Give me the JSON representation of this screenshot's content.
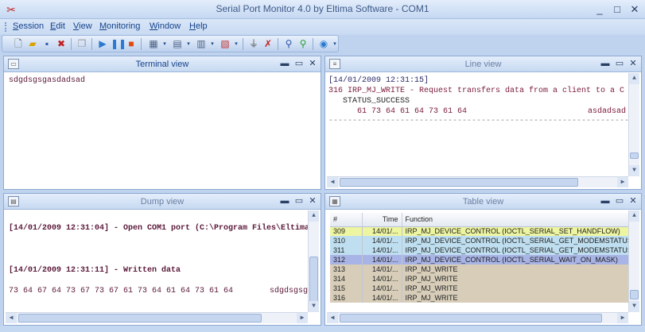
{
  "window": {
    "title": "Serial Port Monitor 4.0 by Eltima Software - COM1",
    "minimize_glyph": "_",
    "maximize_glyph": "□",
    "close_glyph": "✕"
  },
  "menu": {
    "items": [
      {
        "label": "Session",
        "underline": "S"
      },
      {
        "label": "Edit",
        "underline": "E"
      },
      {
        "label": "View",
        "underline": "V"
      },
      {
        "label": "Monitoring",
        "underline": "M"
      },
      {
        "label": "Window",
        "underline": "W"
      },
      {
        "label": "Help",
        "underline": "H"
      }
    ]
  },
  "toolbar": {
    "icons": [
      "new-session-icon",
      "open-icon",
      "save-icon",
      "close-session-icon",
      "copy-icon",
      "start-icon",
      "pause-icon",
      "stop-icon",
      "table-layout-icon",
      "view-layout-icon",
      "dump-layout-icon",
      "line-layout-icon",
      "filter-icon",
      "clear-icon",
      "find-icon",
      "find-next-icon",
      "settings-icon"
    ]
  },
  "panels": {
    "terminal": {
      "title": "Terminal view",
      "content": "sdgdsgsgasdadsad"
    },
    "line": {
      "title": "Line view",
      "timestamp": "[14/01/2009 12:31:15]",
      "request_line": "316  IRP_MJ_WRITE - Request transfers data from a client to a C",
      "status": "STATUS_SUCCESS",
      "hex": "61 73 64 61 64 73 61 64",
      "ascii": "asdadsad",
      "divider": "-------------------------------------------------------------------"
    },
    "dump": {
      "title": "Dump view",
      "line1": "[14/01/2009 12:31:04] - Open COM1 port (C:\\Program Files\\Eltima",
      "line2": "[14/01/2009 12:31:11] - Written data",
      "hex": "73 64 67 64 73 67 73 67 61 73 64 61 64 73 61 64",
      "ascii": "sdgdsgsg"
    },
    "table": {
      "title": "Table view",
      "columns": [
        "#",
        "Time",
        "Function"
      ],
      "rows": [
        {
          "num": "309",
          "time": "14/01/...",
          "function": "IRP_MJ_DEVICE_CONTROL (IOCTL_SERIAL_SET_HANDFLOW)",
          "color": "#eef5a0"
        },
        {
          "num": "310",
          "time": "14/01/...",
          "function": "IRP_MJ_DEVICE_CONTROL (IOCTL_SERIAL_GET_MODEMSTATUS)",
          "color": "#bfdff0"
        },
        {
          "num": "311",
          "time": "14/01/...",
          "function": "IRP_MJ_DEVICE_CONTROL (IOCTL_SERIAL_GET_MODEMSTATUS)",
          "color": "#bfdff0"
        },
        {
          "num": "312",
          "time": "14/01/...",
          "function": "IRP_MJ_DEVICE_CONTROL (IOCTL_SERIAL_WAIT_ON_MASK)",
          "color": "#a9b4e6"
        },
        {
          "num": "313",
          "time": "14/01/...",
          "function": "IRP_MJ_WRITE",
          "color": "#d7cdb9"
        },
        {
          "num": "314",
          "time": "14/01/...",
          "function": "IRP_MJ_WRITE",
          "color": "#d7cdb9"
        },
        {
          "num": "315",
          "time": "14/01/...",
          "function": "IRP_MJ_WRITE",
          "color": "#d7cdb9"
        },
        {
          "num": "316",
          "time": "14/01/...",
          "function": "IRP_MJ_WRITE",
          "color": "#d7cdb9"
        }
      ]
    }
  }
}
